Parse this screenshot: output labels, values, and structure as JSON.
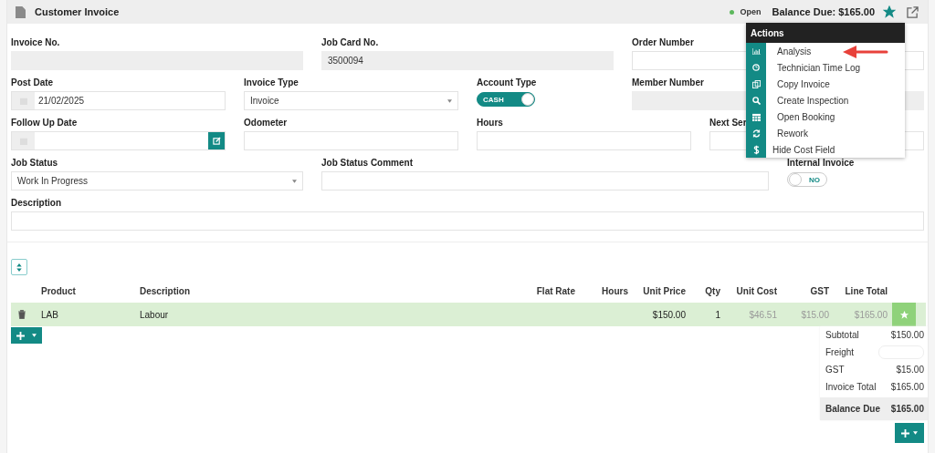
{
  "header": {
    "title": "Customer Invoice",
    "status": {
      "label": "Open",
      "color": "#5cb85c"
    },
    "balance": "Balance Due: $165.00",
    "starred": true
  },
  "form": [
    {
      "label": "Invoice No.",
      "kind": "text",
      "readonly": true
    },
    {
      "label": "Job Card No.",
      "kind": "text",
      "readonly": true,
      "value": "3500094"
    },
    {
      "label": "Order Number",
      "kind": "text",
      "readonly": false
    },
    {
      "label": "Post Date",
      "kind": "date",
      "readonly": false,
      "value": "21/02/2025"
    },
    {
      "label": "Invoice Type",
      "kind": "select",
      "value": "Invoice"
    },
    {
      "label": "Account Type",
      "kind": "toggle",
      "on": true,
      "value": "CASH"
    },
    {
      "label": "Member Number",
      "kind": "text",
      "readonly": true
    },
    {
      "label": "Follow Up Date",
      "kind": "date-edit",
      "readonly": false
    },
    {
      "label": "Odometer",
      "kind": "text",
      "readonly": false
    },
    {
      "label": "Hours",
      "kind": "text",
      "readonly": false
    },
    {
      "label": "Next Ser",
      "kind": "text",
      "readonly": false
    },
    {
      "label": "Job Status",
      "kind": "select",
      "value": "Work In Progress"
    },
    {
      "label": "Job Status Comment",
      "kind": "text",
      "readonly": false
    },
    {
      "label": "Internal Invoice",
      "kind": "toggle",
      "on": false,
      "value": "NO"
    },
    {
      "label": "Description",
      "kind": "text",
      "readonly": false
    }
  ],
  "actions": {
    "title": "Actions",
    "items": [
      {
        "label": "Analysis"
      },
      {
        "label": "Technician Time Log"
      },
      {
        "label": "Copy Invoice"
      },
      {
        "label": "Create Inspection"
      },
      {
        "label": "Open Booking"
      },
      {
        "label": "Rework"
      },
      {
        "label": "Hide Cost Field"
      }
    ]
  },
  "table": {
    "columns": [
      "Product",
      "Description",
      "Flat Rate",
      "Hours",
      "Unit Price",
      "Qty",
      "Unit Cost",
      "GST",
      "Line Total"
    ],
    "rows": [
      {
        "cells": [
          {
            "text": "LAB",
            "muted": false
          },
          {
            "text": "Labour",
            "muted": false
          },
          null,
          null,
          {
            "text": "$150.00",
            "muted": false
          },
          {
            "text": "1",
            "muted": false
          },
          {
            "text": "$46.51",
            "muted": true
          },
          {
            "text": "$15.00",
            "muted": true
          },
          {
            "text": "$165.00",
            "muted": true
          }
        ]
      }
    ]
  },
  "totals": [
    {
      "label": "Subtotal",
      "kind": "value",
      "value": "$150.00"
    },
    {
      "label": "Freight",
      "kind": "input"
    },
    {
      "label": "GST",
      "kind": "value",
      "value": "$15.00"
    },
    {
      "label": "Invoice Total",
      "kind": "value",
      "value": "$165.00"
    },
    {
      "label": "Balance Due",
      "kind": "due",
      "value": "$165.00"
    }
  ]
}
